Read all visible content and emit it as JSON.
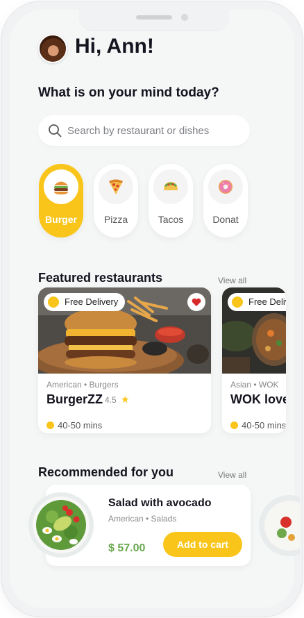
{
  "greeting": {
    "text": "Hi, Ann!"
  },
  "question": "What is on your mind today?",
  "search": {
    "placeholder": "Search by restaurant or dishes",
    "icon": "search-icon"
  },
  "categories": [
    {
      "label": "Burger",
      "icon": "burger-icon",
      "active": true
    },
    {
      "label": "Pizza",
      "icon": "pizza-icon",
      "active": false
    },
    {
      "label": "Tacos",
      "icon": "tacos-icon",
      "active": false
    },
    {
      "label": "Donat",
      "icon": "donut-icon",
      "active": false
    }
  ],
  "featured": {
    "title": "Featured restaurants",
    "view_all": "View all",
    "restaurants": [
      {
        "badge": "Free Delivery",
        "category": "American • Burgers",
        "name": "BurgerZZ",
        "rating": "4.5",
        "time": "40-50 mins",
        "favorite": true
      },
      {
        "badge": "Free Delivery",
        "category": "Asian • WOK",
        "name": "WOK love",
        "time": "40-50 mins"
      }
    ]
  },
  "recommended": {
    "title": "Recommended for you",
    "view_all": "View all",
    "items": [
      {
        "title": "Salad with avocado",
        "category": "American • Salads",
        "price": "$ 57.00",
        "button": "Add to cart"
      }
    ]
  },
  "colors": {
    "accent": "#f9c51a",
    "price": "#6aa84f",
    "text": "#14141f"
  }
}
